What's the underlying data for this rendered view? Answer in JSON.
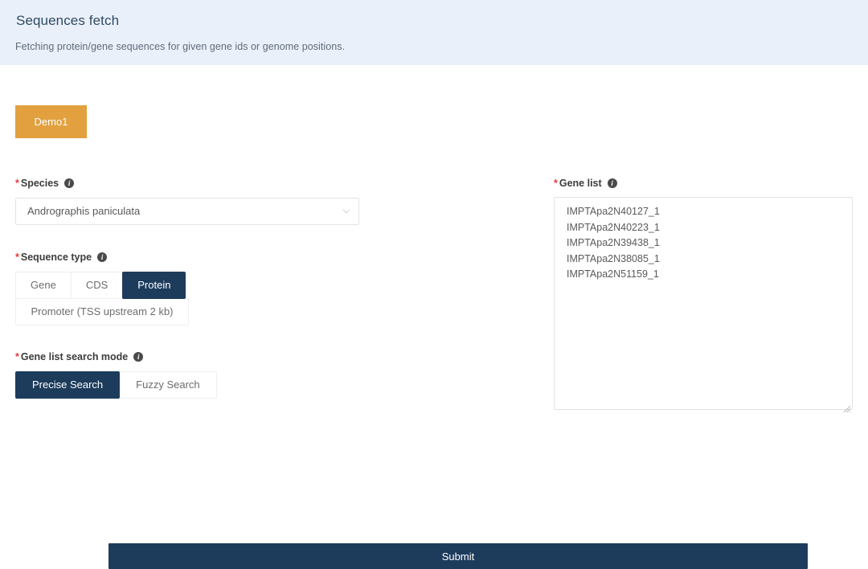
{
  "header": {
    "title": "Sequences fetch",
    "subtitle": "Fetching protein/gene sequences for given gene ids or genome positions."
  },
  "demo": {
    "label": "Demo1"
  },
  "fields": {
    "species": {
      "label": "Species",
      "required_mark": "*",
      "info_glyph": "i",
      "selected": "Andrographis paniculata",
      "chevron": "chevron-down"
    },
    "sequence_type": {
      "label": "Sequence type",
      "required_mark": "*",
      "info_glyph": "i",
      "options": [
        {
          "label": "Gene",
          "selected": false
        },
        {
          "label": "CDS",
          "selected": false
        },
        {
          "label": "Protein",
          "selected": true
        },
        {
          "label": "Promoter (TSS upstream 2 kb)",
          "selected": false
        }
      ]
    },
    "search_mode": {
      "label": "Gene list search mode",
      "required_mark": "*",
      "info_glyph": "i",
      "options": [
        {
          "label": "Precise Search",
          "selected": true
        },
        {
          "label": "Fuzzy Search",
          "selected": false
        }
      ]
    },
    "gene_list": {
      "label": "Gene list",
      "required_mark": "*",
      "info_glyph": "i",
      "value": "IMPTApa2N40127_1\nIMPTApa2N40223_1\nIMPTApa2N39438_1\nIMPTApa2N38085_1\nIMPTApa2N51159_1",
      "placeholder": ""
    }
  },
  "submit": {
    "label": "Submit"
  },
  "colors": {
    "header_band": "#eaf0fa",
    "accent_navy": "#1d3c5c",
    "demo_orange": "#e2a03f",
    "required_red": "#e4393c",
    "border_gray": "#e3e3e3"
  }
}
